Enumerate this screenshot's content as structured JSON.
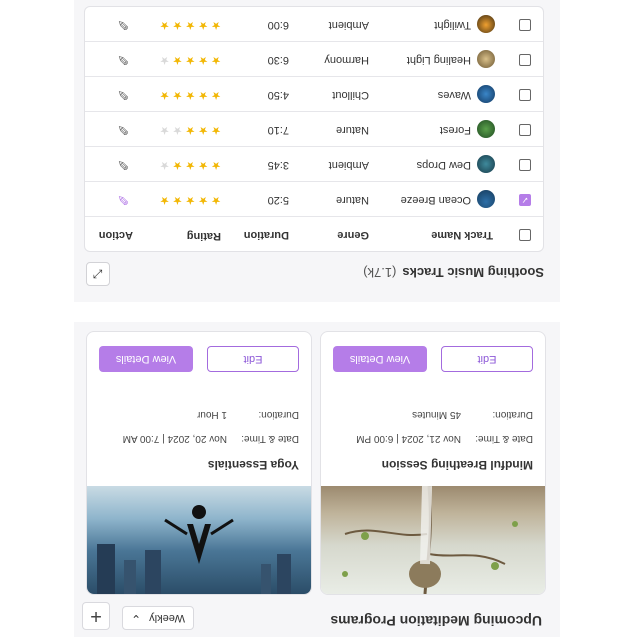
{
  "programs": {
    "title": "Upcoming Meditation Programs",
    "filter": {
      "selected": "Weekly"
    },
    "add_label": "+",
    "cards": [
      {
        "title": "Mindful Breathing Session",
        "date_label": "Date & Time:",
        "date_value": "Nov 21, 2024 | 6:00 PM",
        "duration_label": "Duration:",
        "duration_value": "45 Minutes",
        "edit_label": "Edit",
        "details_label": "View Details"
      },
      {
        "title": "Yoga Essentials",
        "date_label": "Date & Time:",
        "date_value": "Nov 20, 2024 | 7:00 AM",
        "duration_label": "Duration:",
        "duration_value": "1 Hour",
        "edit_label": "Edit",
        "details_label": "View Details"
      }
    ]
  },
  "tracks": {
    "title": "Soothing Music Tracks",
    "count": "(1.7k)",
    "headers": {
      "name": "Track Name",
      "genre": "Genre",
      "duration": "Duration",
      "rating": "Rating",
      "action": "Action"
    },
    "rows": [
      {
        "name": "Ocean Breeze",
        "genre": "Nature",
        "duration": "5:20",
        "rating": 4.5,
        "checked": true
      },
      {
        "name": "Dew Drops",
        "genre": "Ambient",
        "duration": "3:45",
        "rating": 4,
        "checked": false
      },
      {
        "name": "Forest",
        "genre": "Nature",
        "duration": "7:10",
        "rating": 3,
        "checked": false
      },
      {
        "name": "Waves",
        "genre": "Chillout",
        "duration": "4:50",
        "rating": 4.5,
        "checked": false
      },
      {
        "name": "Healing Light",
        "genre": "Harmony",
        "duration": "6:30",
        "rating": 4,
        "checked": false
      },
      {
        "name": "Twilight",
        "genre": "Ambient",
        "duration": "6:00",
        "rating": 5,
        "checked": false
      }
    ]
  },
  "colors": {
    "accent": "#b57de8",
    "star": "#f2b705"
  }
}
